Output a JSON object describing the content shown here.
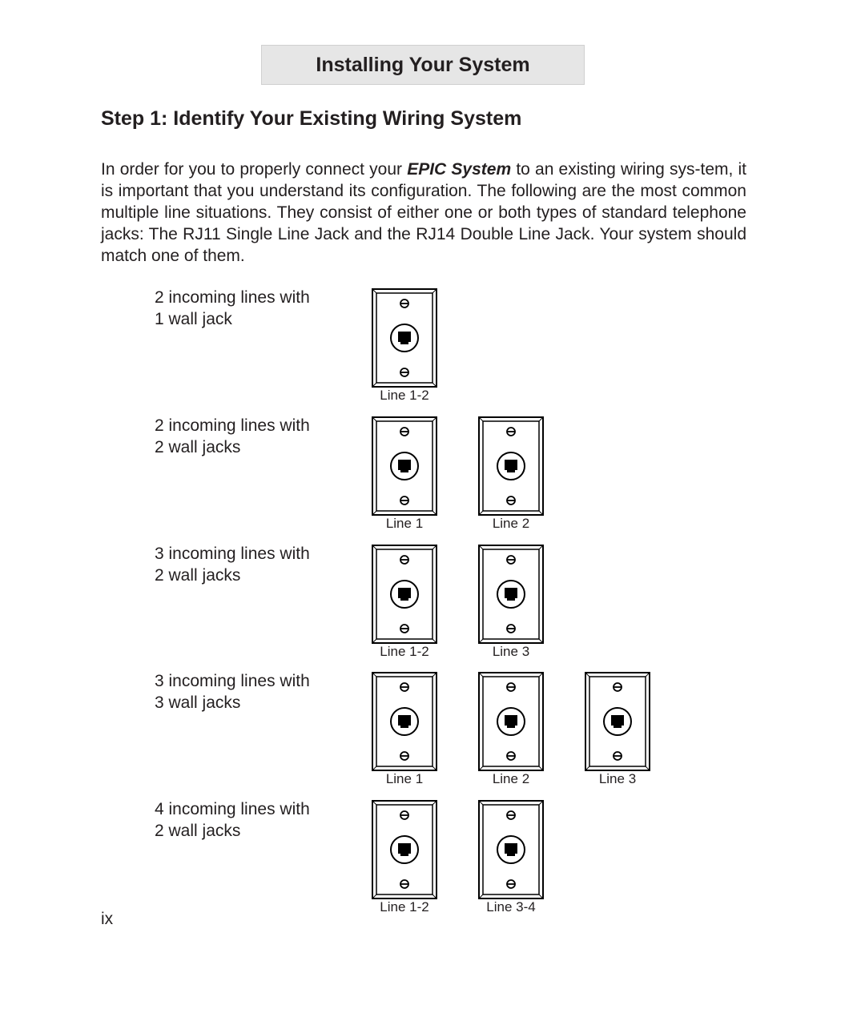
{
  "header": {
    "section_title": "Installing Your System"
  },
  "step": {
    "title": "Step 1: Identify Your Existing Wiring System"
  },
  "intro": {
    "before": "In order for you to properly connect your ",
    "emphasis": "EPIC System",
    "after": " to an existing wiring sys-tem, it is important that you understand its configuration.  The following are the most common multiple line situations.  They consist of either one or both types of standard telephone jacks:  The RJ11 Single Line Jack and the RJ14 Double Line Jack.  Your system should match one of them."
  },
  "configurations": [
    {
      "line1": "2 incoming lines with",
      "line2": "1 wall jack",
      "jacks": [
        "Line 1-2"
      ]
    },
    {
      "line1": "2 incoming lines with",
      "line2": "2 wall jacks",
      "jacks": [
        "Line 1",
        "Line 2"
      ]
    },
    {
      "line1": "3 incoming lines with",
      "line2": "2 wall jacks",
      "jacks": [
        "Line 1-2",
        "Line 3"
      ]
    },
    {
      "line1": "3 incoming lines with",
      "line2": "3 wall jacks",
      "jacks": [
        "Line 1",
        "Line 2",
        "Line 3"
      ]
    },
    {
      "line1": "4 incoming lines with",
      "line2": "2 wall jacks",
      "jacks": [
        "Line 1-2",
        "Line 3-4"
      ]
    }
  ],
  "footer": {
    "page_number": "ix"
  },
  "icons": {
    "jack": "wall-jack-icon",
    "screw": "screw-icon",
    "port": "phone-port-icon"
  }
}
